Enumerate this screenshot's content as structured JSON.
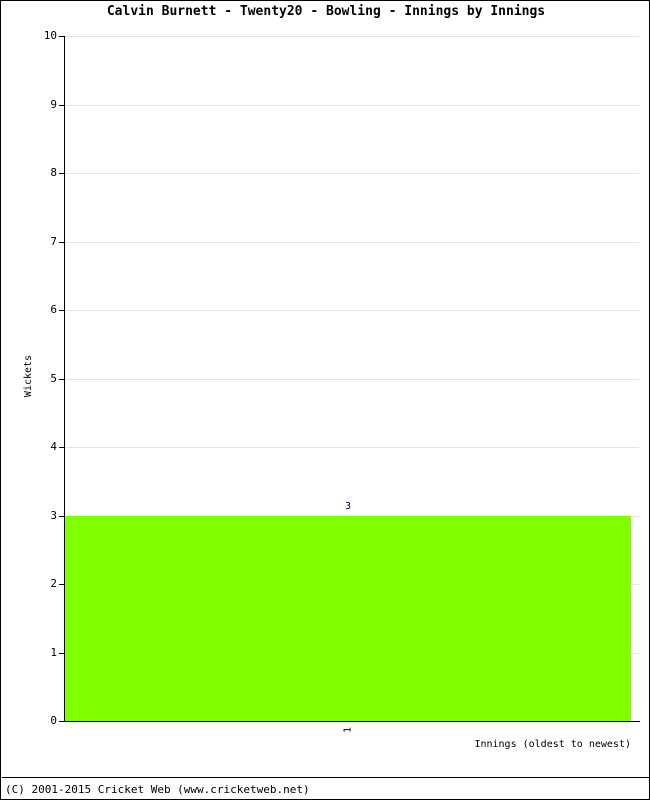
{
  "title": "Calvin Burnett - Twenty20 - Bowling - Innings by Innings",
  "footer": "(C) 2001-2015 Cricket Web (www.cricketweb.net)",
  "colors": {
    "bar": "#80ff00",
    "bar_label": "#000080",
    "gridline": "#e3e3e3",
    "axis": "#000000",
    "background": "#ffffff"
  },
  "chart_data": {
    "type": "bar",
    "title": "Calvin Burnett - Twenty20 - Bowling - Innings by Innings",
    "xlabel": "Innings (oldest to newest)",
    "ylabel": "Wickets",
    "categories": [
      "1"
    ],
    "values": [
      3
    ],
    "data_labels": [
      "3"
    ],
    "ylim": [
      0,
      10
    ],
    "yticks": [
      0,
      1,
      2,
      3,
      4,
      5,
      6,
      7,
      8,
      9,
      10
    ],
    "ytick_labels": [
      "0",
      "1",
      "2",
      "3",
      "4",
      "5",
      "6",
      "7",
      "8",
      "9",
      "10"
    ],
    "xtick_labels": [
      "1"
    ],
    "xtick_rotation": 90,
    "grid": true,
    "legend": false,
    "series": [
      {
        "name": "Wickets",
        "values": [
          3
        ],
        "color": "#80ff00"
      }
    ]
  }
}
